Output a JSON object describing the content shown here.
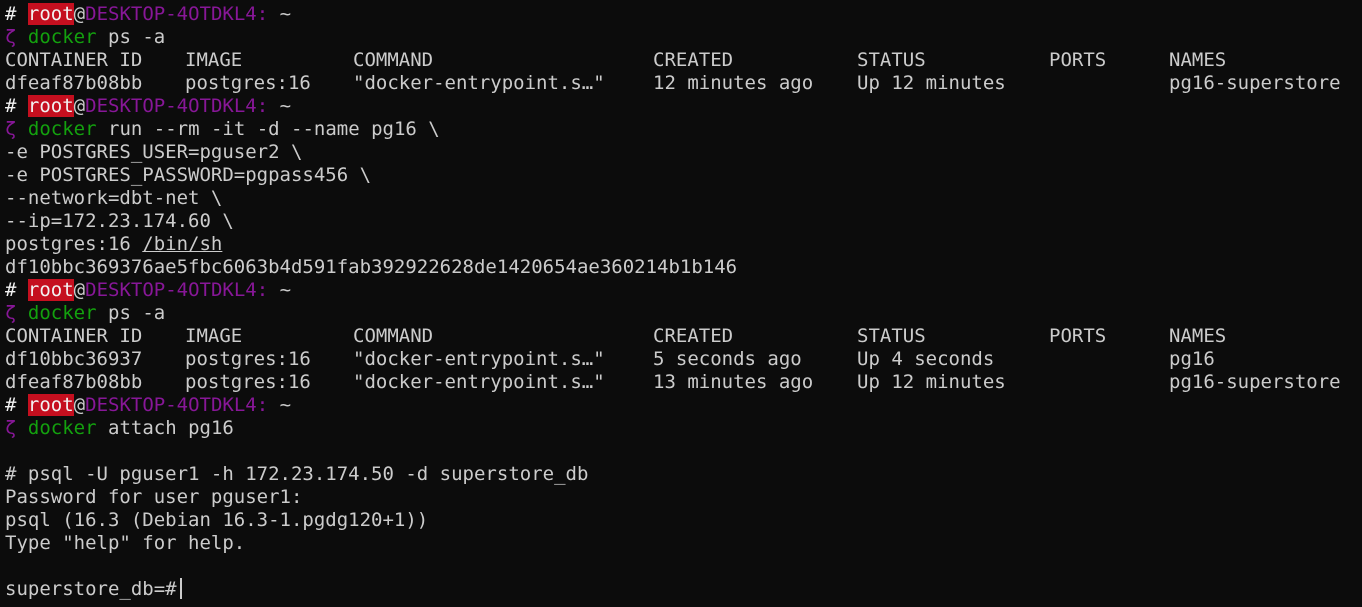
{
  "prompt": {
    "hash": "#",
    "user": "root",
    "at": "@",
    "host": "DESKTOP-4OTDKL4:",
    "path": "~",
    "symbol": "ζ"
  },
  "commands": [
    {
      "bin": "docker",
      "args": "ps -a"
    },
    {
      "bin": "docker",
      "args": "run --rm -it -d --name pg16 \\"
    },
    {
      "bin": "docker",
      "args": "ps -a"
    },
    {
      "bin": "docker",
      "args": "attach pg16"
    }
  ],
  "ps_headers": [
    "CONTAINER ID",
    "IMAGE",
    "COMMAND",
    "CREATED",
    "STATUS",
    "PORTS",
    "NAMES"
  ],
  "ps1_rows": [
    [
      "dfeaf87b08bb",
      "postgres:16",
      "\"docker-entrypoint.s…\"",
      "12 minutes ago",
      "Up 12 minutes",
      "",
      "pg16-superstore"
    ]
  ],
  "run_continuation": [
    "-e POSTGRES_USER=pguser2 \\",
    "-e POSTGRES_PASSWORD=pgpass456 \\",
    "--network=dbt-net \\",
    "--ip=172.23.174.60 \\"
  ],
  "run_last": {
    "image": "postgres:16",
    "shell": "/bin/sh"
  },
  "container_hash": "df10bbc369376ae5fbc6063b4d591fab392922628de1420654ae360214b1b146",
  "ps2_rows": [
    [
      "df10bbc36937",
      "postgres:16",
      "\"docker-entrypoint.s…\"",
      "5 seconds ago",
      "Up 4 seconds",
      "",
      "pg16"
    ],
    [
      "dfeaf87b08bb",
      "postgres:16",
      "\"docker-entrypoint.s…\"",
      "13 minutes ago",
      "Up 12 minutes",
      "",
      "pg16-superstore"
    ]
  ],
  "psql_session": [
    "",
    "# psql -U pguser1 -h 172.23.174.50 -d superstore_db",
    "Password for user pguser1:",
    "psql (16.3 (Debian 16.3-1.pgdg120+1))",
    "Type \"help\" for help.",
    ""
  ],
  "final_prompt": "superstore_db=#"
}
